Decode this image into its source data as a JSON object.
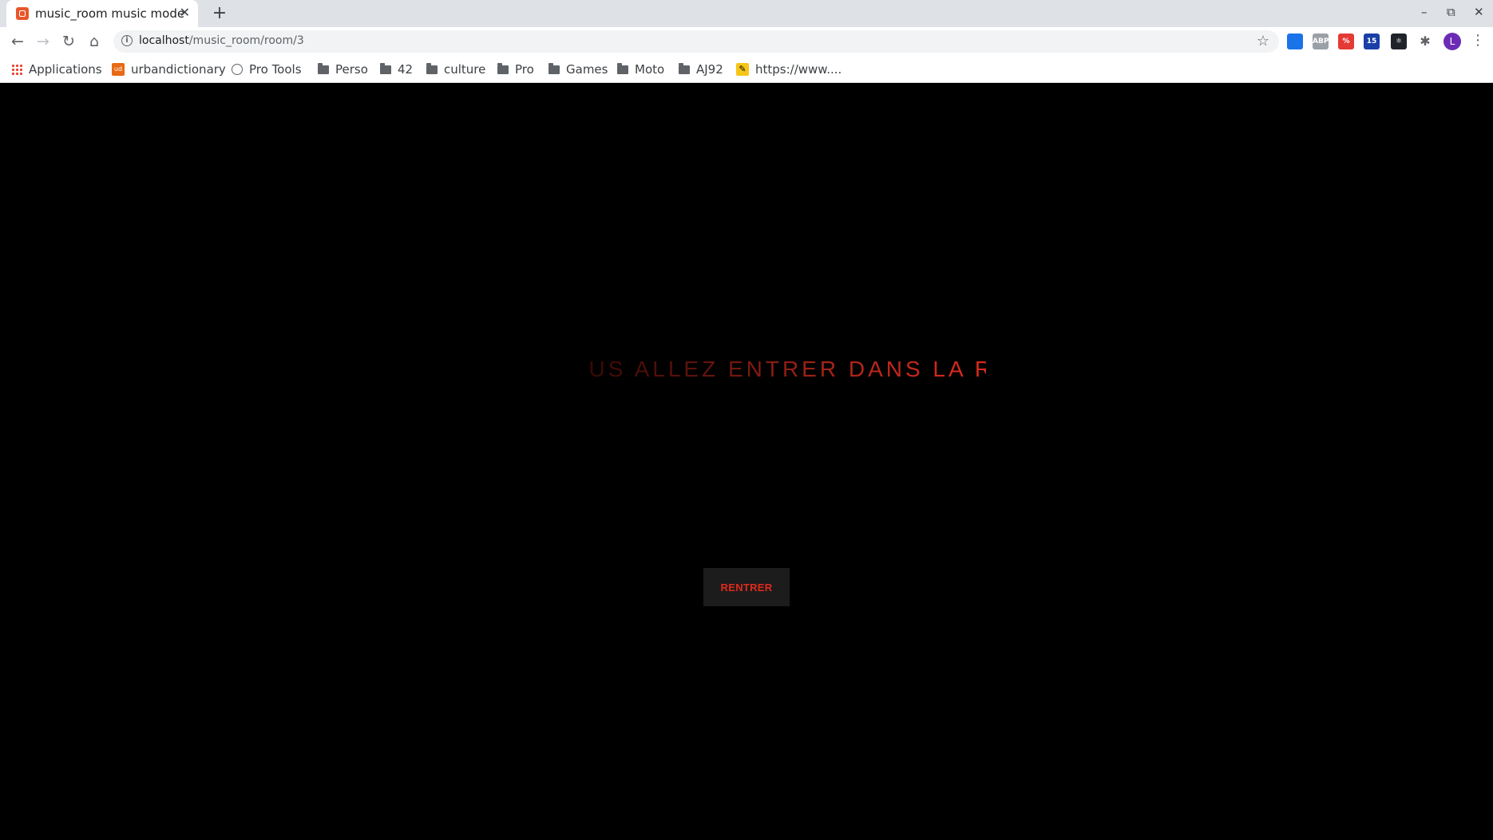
{
  "browser": {
    "tab": {
      "title": "music_room music mode",
      "close_symbol": "✕"
    },
    "new_tab_symbol": "+",
    "window_controls": {
      "minimize": "–",
      "restore": "⧉",
      "close": "✕"
    },
    "address_bar": {
      "host": "localhost",
      "path": "/music_room/room/3"
    },
    "extensions": [
      {
        "name": "window-extension-icon",
        "color": "#1a73e8",
        "text": ""
      },
      {
        "name": "adblock-plus-icon",
        "color": "#9aa0a6",
        "text": "ABP"
      },
      {
        "name": "pdf-extension-icon",
        "color": "#e53935",
        "text": "%"
      },
      {
        "name": "graduation-extension-icon",
        "color": "#1a3fa8",
        "text": "15"
      },
      {
        "name": "react-devtools-icon",
        "color": "#20232a",
        "text": "⚛"
      }
    ],
    "profile_initial": "L",
    "bookmarks": [
      {
        "label": "Applications",
        "icon": "apps-grid-icon"
      },
      {
        "label": "urbandictionary",
        "icon": "urbandictionary-icon"
      },
      {
        "label": "Pro Tools",
        "icon": "globe-icon"
      },
      {
        "label": "Perso",
        "icon": "folder-icon"
      },
      {
        "label": "42",
        "icon": "folder-icon"
      },
      {
        "label": "culture",
        "icon": "folder-icon"
      },
      {
        "label": "Pro",
        "icon": "folder-icon"
      },
      {
        "label": "Games",
        "icon": "folder-icon"
      },
      {
        "label": "Moto",
        "icon": "folder-icon"
      },
      {
        "label": "AJ92",
        "icon": "folder-icon"
      },
      {
        "label": "https://www....",
        "icon": "pen-icon"
      }
    ]
  },
  "page": {
    "background": "#000000",
    "accent_color": "#e0291b",
    "marquee_text": "VOUS ALLEZ ENTRER DANS LA ROOM",
    "enter_button_label": "RENTRER"
  }
}
